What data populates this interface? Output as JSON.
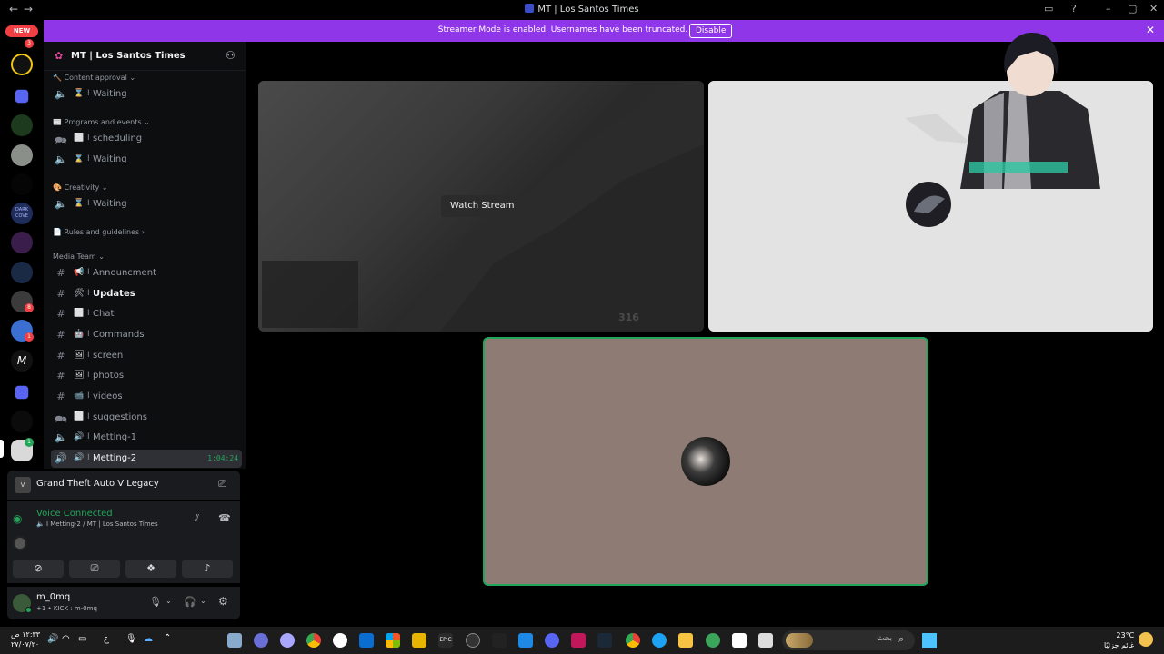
{
  "titlebar": {
    "title": "MT | Los Santos Times"
  },
  "banner": {
    "message": "Streamer Mode is enabled. Usernames have been truncated.",
    "button": "Disable"
  },
  "servers": {
    "new_badge": "NEW",
    "badges": [
      "3",
      "8",
      "1",
      "1"
    ],
    "dark_cove": "DARK\nCOVE"
  },
  "server": {
    "name": "MT | Los Santos Times"
  },
  "categories": {
    "content_approval": "Content approval",
    "programs": "Programs and events",
    "creativity": "Creativity",
    "rules": "Rules and guidelines",
    "media": "Media Team"
  },
  "channels": [
    {
      "icon": "speaker",
      "emoji": "⌛",
      "name": "Waiting"
    },
    {
      "icon": "speaker-chat",
      "emoji": "⬜",
      "name": "scheduling"
    },
    {
      "icon": "speaker",
      "emoji": "⌛",
      "name": "Waiting"
    },
    {
      "icon": "speaker",
      "emoji": "⌛",
      "name": "Waiting"
    },
    {
      "icon": "hash",
      "emoji": "📢",
      "name": "Announcment"
    },
    {
      "icon": "hash",
      "emoji": "🛠",
      "name": "Updates"
    },
    {
      "icon": "hash",
      "emoji": "⬜",
      "name": "Chat"
    },
    {
      "icon": "hash",
      "emoji": "🤖",
      "name": "Commands"
    },
    {
      "icon": "hash",
      "emoji": "🖼",
      "name": "screen"
    },
    {
      "icon": "hash",
      "emoji": "🖼",
      "name": "photos"
    },
    {
      "icon": "hash",
      "emoji": "📹",
      "name": "videos"
    },
    {
      "icon": "forum",
      "emoji": "⬜",
      "name": "suggestions"
    },
    {
      "icon": "speaker",
      "emoji": "🔊",
      "name": "Metting-1"
    },
    {
      "icon": "speaker-live",
      "emoji": "🔊",
      "name": "Metting-2",
      "timer": "1:04:24"
    }
  ],
  "separator": "I",
  "game": {
    "name": "Grand Theft Auto V Legacy"
  },
  "voice": {
    "status": "Voice Connected",
    "location": "I Metting-2 / MT | Los Santos Times"
  },
  "user": {
    "name": "m_0mq",
    "status": "+1 • KICK : m-0mq"
  },
  "stage": {
    "watch_stream": "Watch Stream",
    "stream_counter": "316"
  },
  "taskbar": {
    "time": "١٢:٣٣ ص",
    "date": "٢٧/٠٧/٢٠",
    "lang": "ع",
    "search_placeholder": "بحث",
    "weather_temp": "23°C",
    "weather_desc": "غائم جزئيًا"
  },
  "colors": {
    "banner": "#8f36e8",
    "voice_green": "#23a55a",
    "tile_brown": "#8e7b74"
  }
}
